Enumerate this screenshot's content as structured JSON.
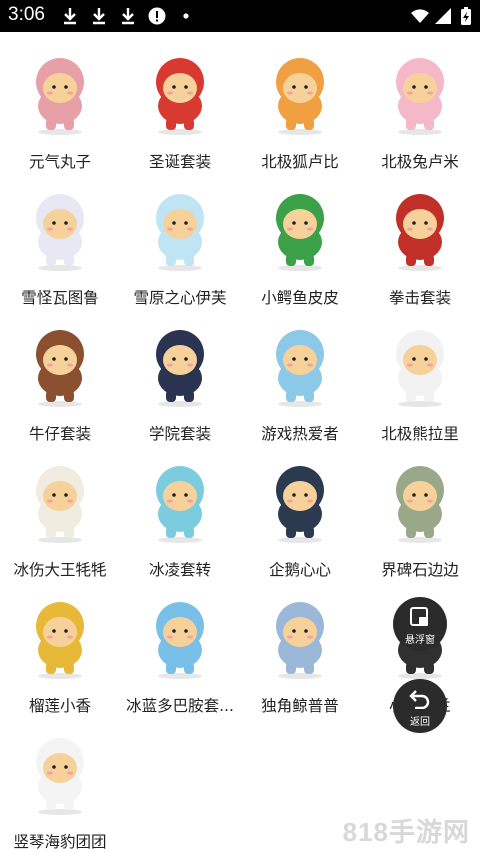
{
  "status_bar": {
    "time": "3:06"
  },
  "skins": [
    {
      "name": "元气丸子",
      "color": "#e8a0a8"
    },
    {
      "name": "圣诞套装",
      "color": "#d83a32"
    },
    {
      "name": "北极狐卢比",
      "color": "#f0a040"
    },
    {
      "name": "北极兔卢米",
      "color": "#f4b8c8"
    },
    {
      "name": "雪怪瓦图鲁",
      "color": "#e8e8f4"
    },
    {
      "name": "雪原之心伊芙",
      "color": "#bfe4f4"
    },
    {
      "name": "小鳄鱼皮皮",
      "color": "#3ca048"
    },
    {
      "name": "拳击套装",
      "color": "#c03028"
    },
    {
      "name": "牛仔套装",
      "color": "#8a5030"
    },
    {
      "name": "学院套装",
      "color": "#2a3450"
    },
    {
      "name": "游戏热爱者",
      "color": "#8cc8e8"
    },
    {
      "name": "北极熊拉里",
      "color": "#f2f2f2"
    },
    {
      "name": "冰伤大王牦牦",
      "color": "#f0ece0"
    },
    {
      "name": "冰凌套转",
      "color": "#7ccce0"
    },
    {
      "name": "企鹅心心",
      "color": "#2c3a50"
    },
    {
      "name": "界碑石边边",
      "color": "#9aa88a"
    },
    {
      "name": "榴莲小香",
      "color": "#e8b838"
    },
    {
      "name": "冰蓝多巴胺套...",
      "color": "#78c0e8"
    },
    {
      "name": "独角鲸普普",
      "color": "#9cb8d8"
    },
    {
      "name": "小海兰兰",
      "color": "#303030"
    },
    {
      "name": "竖琴海豹团团",
      "color": "#f4f4f4"
    }
  ],
  "floating": {
    "float_window_label": "悬浮窗",
    "back_label": "返回"
  },
  "watermark": "818手游网"
}
